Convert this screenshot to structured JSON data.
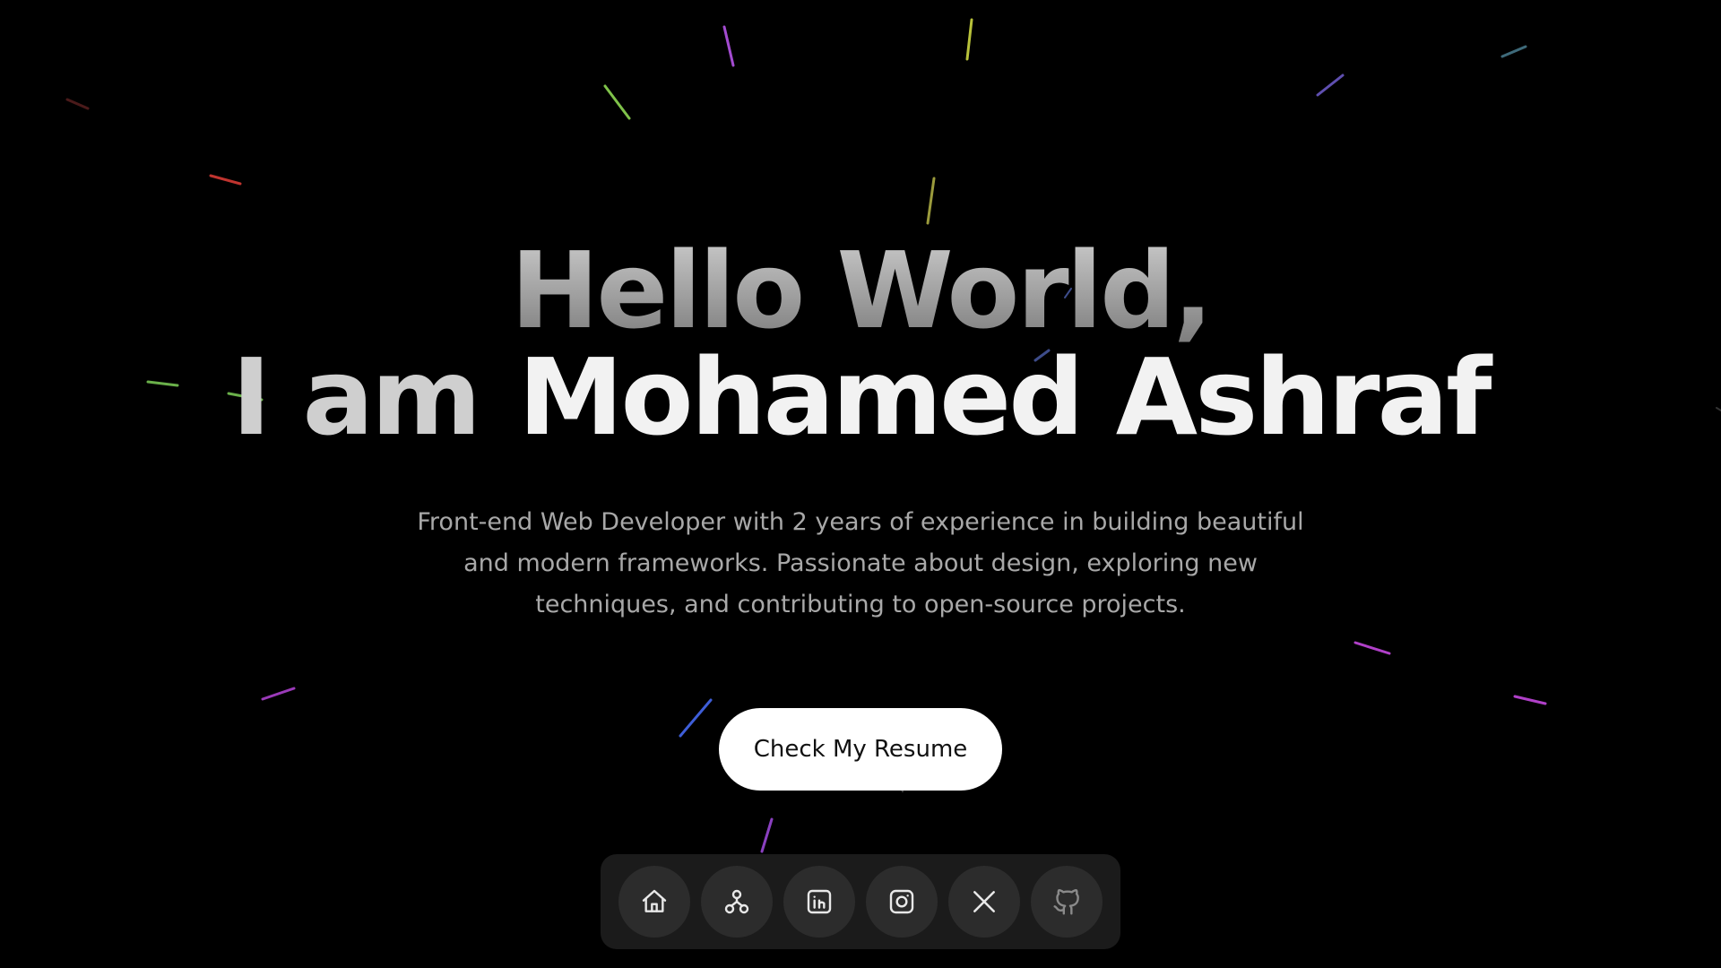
{
  "hero": {
    "line1": "Hello World,",
    "prefix": "I am",
    "name": "Mohamed Ashraf",
    "bio": "Front-end Web Developer with 2 years of experience in building beautiful and modern frameworks. Passionate about design, exploring new techniques, and contributing to open-source projects.",
    "cta_label": "Check My Resume"
  },
  "dock": {
    "items": [
      {
        "icon": "home-icon"
      },
      {
        "icon": "sitemap-icon"
      },
      {
        "icon": "linkedin-icon"
      },
      {
        "icon": "instagram-icon"
      },
      {
        "icon": "x-icon"
      },
      {
        "icon": "github-icon"
      }
    ]
  },
  "colors": {
    "background": "#000000",
    "heading_gradient_top": "#c9c9c9",
    "heading_gradient_bottom": "#7d7d7d",
    "name": "#f2f2f2",
    "bio_text": "#a8a8a8",
    "button_bg": "#ffffff",
    "dock_bg": "#1b1b1b",
    "dock_button_bg": "#2c2c2c"
  }
}
